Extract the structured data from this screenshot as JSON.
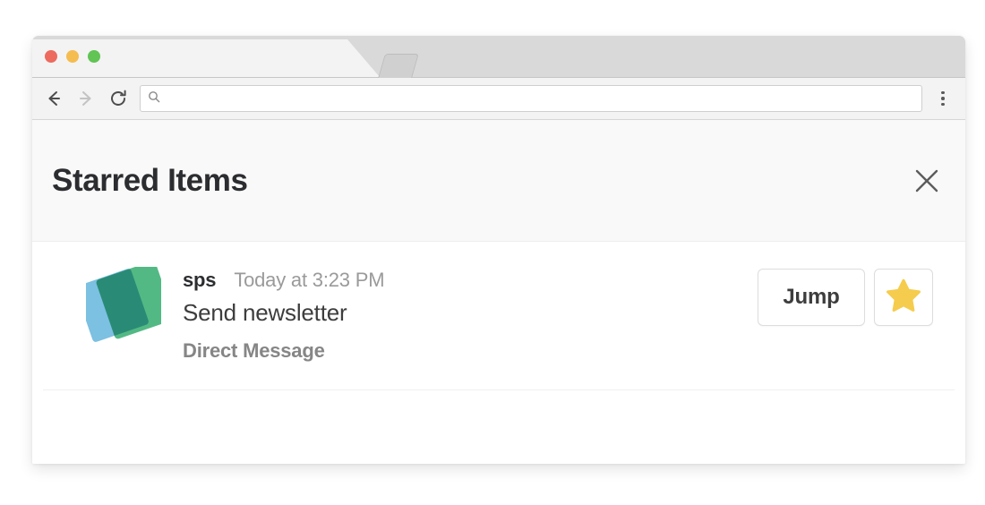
{
  "browser": {
    "traffic_lights": [
      {
        "name": "close",
        "color": "#ed6a5e"
      },
      {
        "name": "minimize",
        "color": "#f5bd4f"
      },
      {
        "name": "maximize",
        "color": "#61c454"
      }
    ],
    "toolbar": {
      "back_icon": "arrow-left-icon",
      "forward_icon": "arrow-right-icon",
      "reload_icon": "reload-icon",
      "menu_icon": "three-dot-menu-icon",
      "address_value": "",
      "address_placeholder": "",
      "address_icon": "search-icon"
    },
    "tab": {
      "title": "",
      "new_tab_icon": "new-tab-icon"
    }
  },
  "panel": {
    "title": "Starred Items",
    "close_icon": "close-icon",
    "close_label": "Close"
  },
  "starred_items": [
    {
      "avatar": "sps-avatar",
      "author": "sps",
      "timestamp": "Today at 3:23 PM",
      "message": "Send newsletter",
      "context": "Direct Message",
      "jump_label": "Jump",
      "star_icon": "star-icon",
      "star_filled": true
    }
  ],
  "colors": {
    "title_text": "#2c2d30",
    "muted_text": "#868686",
    "timestamp_text": "#9a9a9a",
    "message_text": "#3d3d3d",
    "star_gold": "#f5cc4d",
    "panel_header_bg": "#f9f9f9",
    "avatar_blue": "#7cc0e2",
    "avatar_green": "#44b37a"
  }
}
